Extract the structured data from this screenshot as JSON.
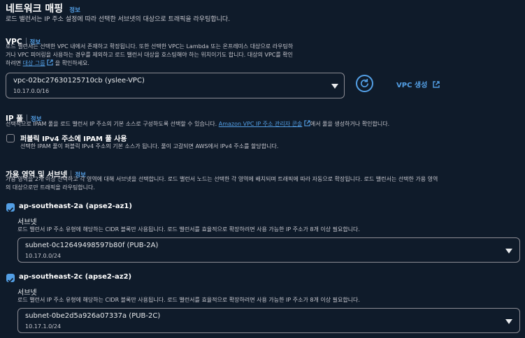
{
  "header": {
    "title": "네트워크 매핑",
    "info": "정보",
    "description": "로드 밸런서는 IP 주소 설정에 따라 선택한 서브넷의 대상으로 트래픽을 라우팅합니다."
  },
  "vpc": {
    "label": "VPC",
    "info": "정보",
    "desc_line1": "로드 밸런서는 선택한 VPC 내에서 존재하고 확장됩니다. 또한 선택한 VPC는 Lambda 또는 온프레미스 대상으로 라우팅하",
    "desc_line2": "거나 VPC 피어링을 사용하는 경우를 제외하고 로드 밸런서 대상을 호스팅해야 하는 위치이기도 합니다. 대상의 VPC를 확인",
    "desc_line3_pre": "하려면",
    "desc_link": "대상 그룹",
    "desc_line3_post": "을 확인하세요.",
    "selected": "vpc-02bc27630125710cb (yslee-VPC)",
    "cidr": "10.17.0.0/16",
    "create_label": "VPC 생성"
  },
  "ipam": {
    "label": "IP 풀",
    "info": "정보",
    "desc_pre": "선택적으로 IPAM 풀을 로드 밸런서 IP 주소의 기본 소스로 구성하도록 선택할 수 있습니다.",
    "desc_link": "Amazon VPC IP 주소 관리자 콘솔",
    "desc_post": "에서 풀을 생성하거나 확인합니다.",
    "checkbox_label": "퍼블릭 IPv4 주소에 IPAM 풀 사용",
    "checkbox_desc": "선택한 IPAM 풀이 퍼블릭 IPv4 주소의 기본 소스가 됩니다. 풀이 고갈되면 AWS에서 IPv4 주소를 할당합니다."
  },
  "az": {
    "label": "가용 영역 및 서브넷",
    "info": "정보",
    "desc_line1": "가용 영역을 2개 이상 선택하고 각 영역에 대해 서브넷을 선택합니다. 로드 밸런서 노드는 선택한 각 영역에 배치되며 트래픽에 따라 자동으로 확장됩니다. 로드 밸런서는 선택한 가용 영역",
    "desc_line2": "의 대상으로만 트래픽을 라우팅합니다.",
    "zones": [
      {
        "name": "ap-southeast-2a (apse2-az1)",
        "subnet_label": "서브넷",
        "subnet_desc": "로드 밸런서 IP 주소 유형에 해당하는 CIDR 블록만 사용됩니다. 로드 밸런서를 효율적으로 확장하려면 사용 가능한 IP 주소가 8개 이상 필요합니다.",
        "subnet": "subnet-0c12649498597b80f (PUB-2A)",
        "cidr": "10.17.0.0/24"
      },
      {
        "name": "ap-southeast-2c (apse2-az2)",
        "subnet_label": "서브넷",
        "subnet_desc": "로드 밸런서 IP 주소 유형에 해당하는 CIDR 블록만 사용됩니다. 로드 밸런서를 효율적으로 확장하려면 사용 가능한 IP 주소가 8개 이상 필요합니다.",
        "subnet": "subnet-0be2d5a926a07337a (PUB-2C)",
        "cidr": "10.17.1.0/24"
      }
    ]
  },
  "colors": {
    "background": "#0f1b2a",
    "link": "#539fe5",
    "border": "#8c8c94"
  },
  "icons": [
    "refresh-icon",
    "external-link-icon",
    "checkbox-icon",
    "caret-down-icon"
  ]
}
